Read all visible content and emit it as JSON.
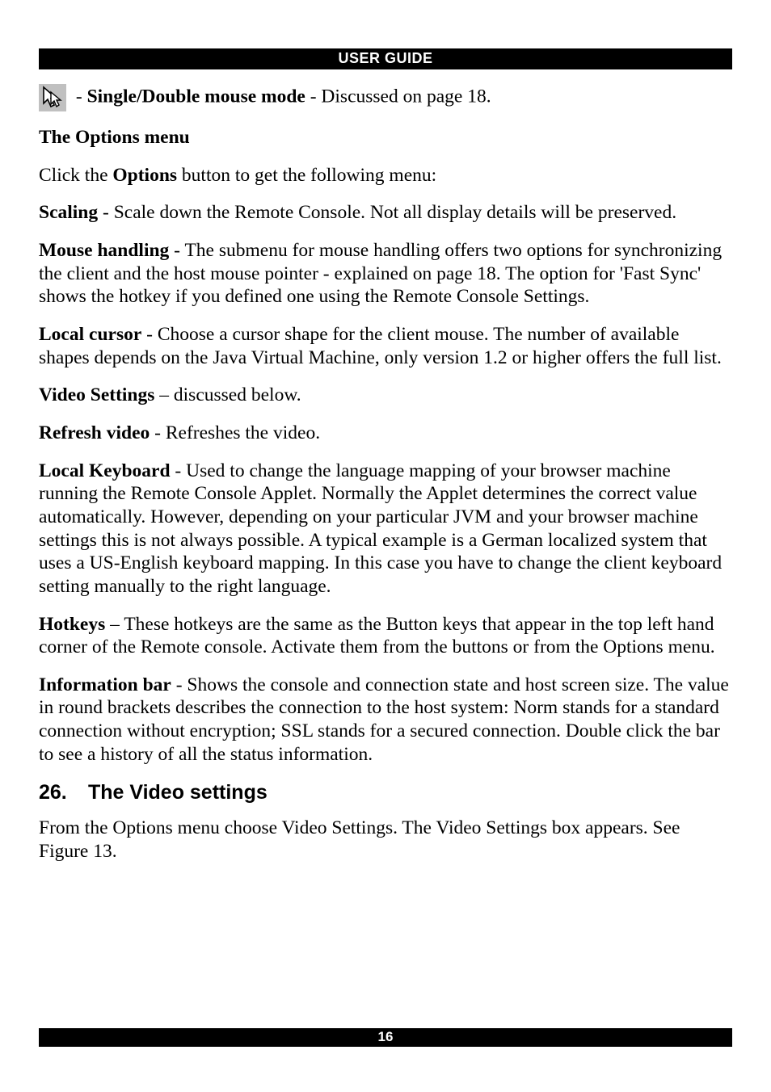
{
  "header": {
    "title": "USER GUIDE"
  },
  "footer": {
    "page_number": "16"
  },
  "body": {
    "mouse_mode": {
      "sep": " - ",
      "label": "Single/Double mouse mode",
      "rest": " - Discussed on page 18."
    },
    "options_heading": "The Options menu",
    "options_intro_pre": "Click the ",
    "options_intro_bold": "Options",
    "options_intro_post": " button to get the following menu:",
    "scaling": {
      "label": "Scaling",
      "rest": " - Scale down the Remote Console. Not all display details will be preserved."
    },
    "mouse_handling": {
      "label": "Mouse handling",
      "rest": " - The submenu for mouse handling offers two options for synchronizing the client and the host mouse pointer - explained on page 18. The option for 'Fast Sync' shows the hotkey if you defined one using the Remote Console Settings."
    },
    "local_cursor": {
      "label": "Local cursor",
      "rest": " - Choose a cursor shape for the client mouse. The number of available shapes depends on the Java Virtual Machine, only version 1.2 or higher offers the full list."
    },
    "video_settings": {
      "label": "Video Settings",
      "rest": " – discussed below."
    },
    "refresh_video": {
      "label": "Refresh video",
      "rest": " - Refreshes the video."
    },
    "local_keyboard": {
      "label": "Local Keyboard",
      "rest": " - Used to change the language mapping of your browser machine running the Remote Console Applet. Normally the Applet determines the correct value automatically. However, depending on your particular JVM and your browser machine settings this is not always possible. A typical example is a German localized system that uses a US-English keyboard mapping. In this case you have to change the client keyboard setting manually to the right language."
    },
    "hotkeys": {
      "label": "Hotkeys",
      "rest": " – These hotkeys are the same as the Button keys that appear in the top left hand corner of the Remote console. Activate them from the buttons or from the Options menu."
    },
    "information_bar": {
      "label": "Information bar",
      "rest": " - Shows the console and connection state and host screen size. The value in round brackets describes the connection to the host system: Norm stands for a standard connection without encryption; SSL stands for a secured connection. Double click the bar to see a history of all the status information."
    },
    "section": {
      "number": "26.",
      "title": "The Video settings",
      "intro": "From the Options menu choose Video Settings. The Video Settings box appears. See Figure 13."
    }
  }
}
